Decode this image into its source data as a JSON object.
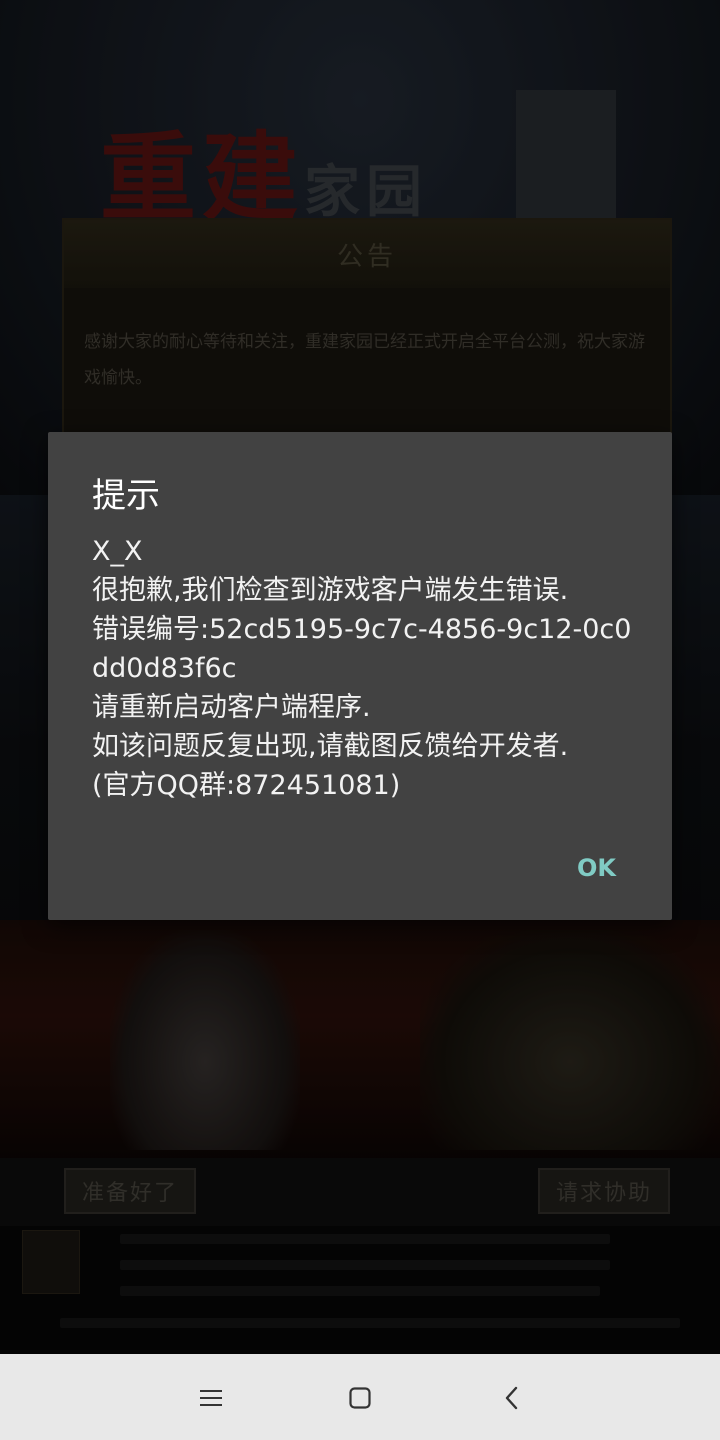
{
  "game": {
    "logo_main": "重建",
    "logo_sub": "家园",
    "notice": {
      "title": "公告",
      "body": "感谢大家的耐心等待和关注，重建家园已经正式开启全平台公测，祝大家游戏愉快。"
    },
    "buttons": {
      "ready": "准备好了",
      "help": "请求协助"
    }
  },
  "dialog": {
    "title": "提示",
    "lines": [
      "X_X",
      "很抱歉,我们检查到游戏客户端发生错误.",
      "错误编号:52cd5195-9c7c-4856-9c12-0c0dd0d83f6c",
      "请重新启动客户端程序.",
      "如该问题反复出现,请截图反馈给开发者.",
      "(官方QQ群:872451081)"
    ],
    "ok_label": "OK"
  },
  "navbar": {
    "icons": [
      "menu-icon",
      "home-icon",
      "back-icon"
    ]
  },
  "colors": {
    "dialog_bg": "#424242",
    "ok_accent": "#80cbc4",
    "navbar_bg": "#e8e8e8"
  }
}
